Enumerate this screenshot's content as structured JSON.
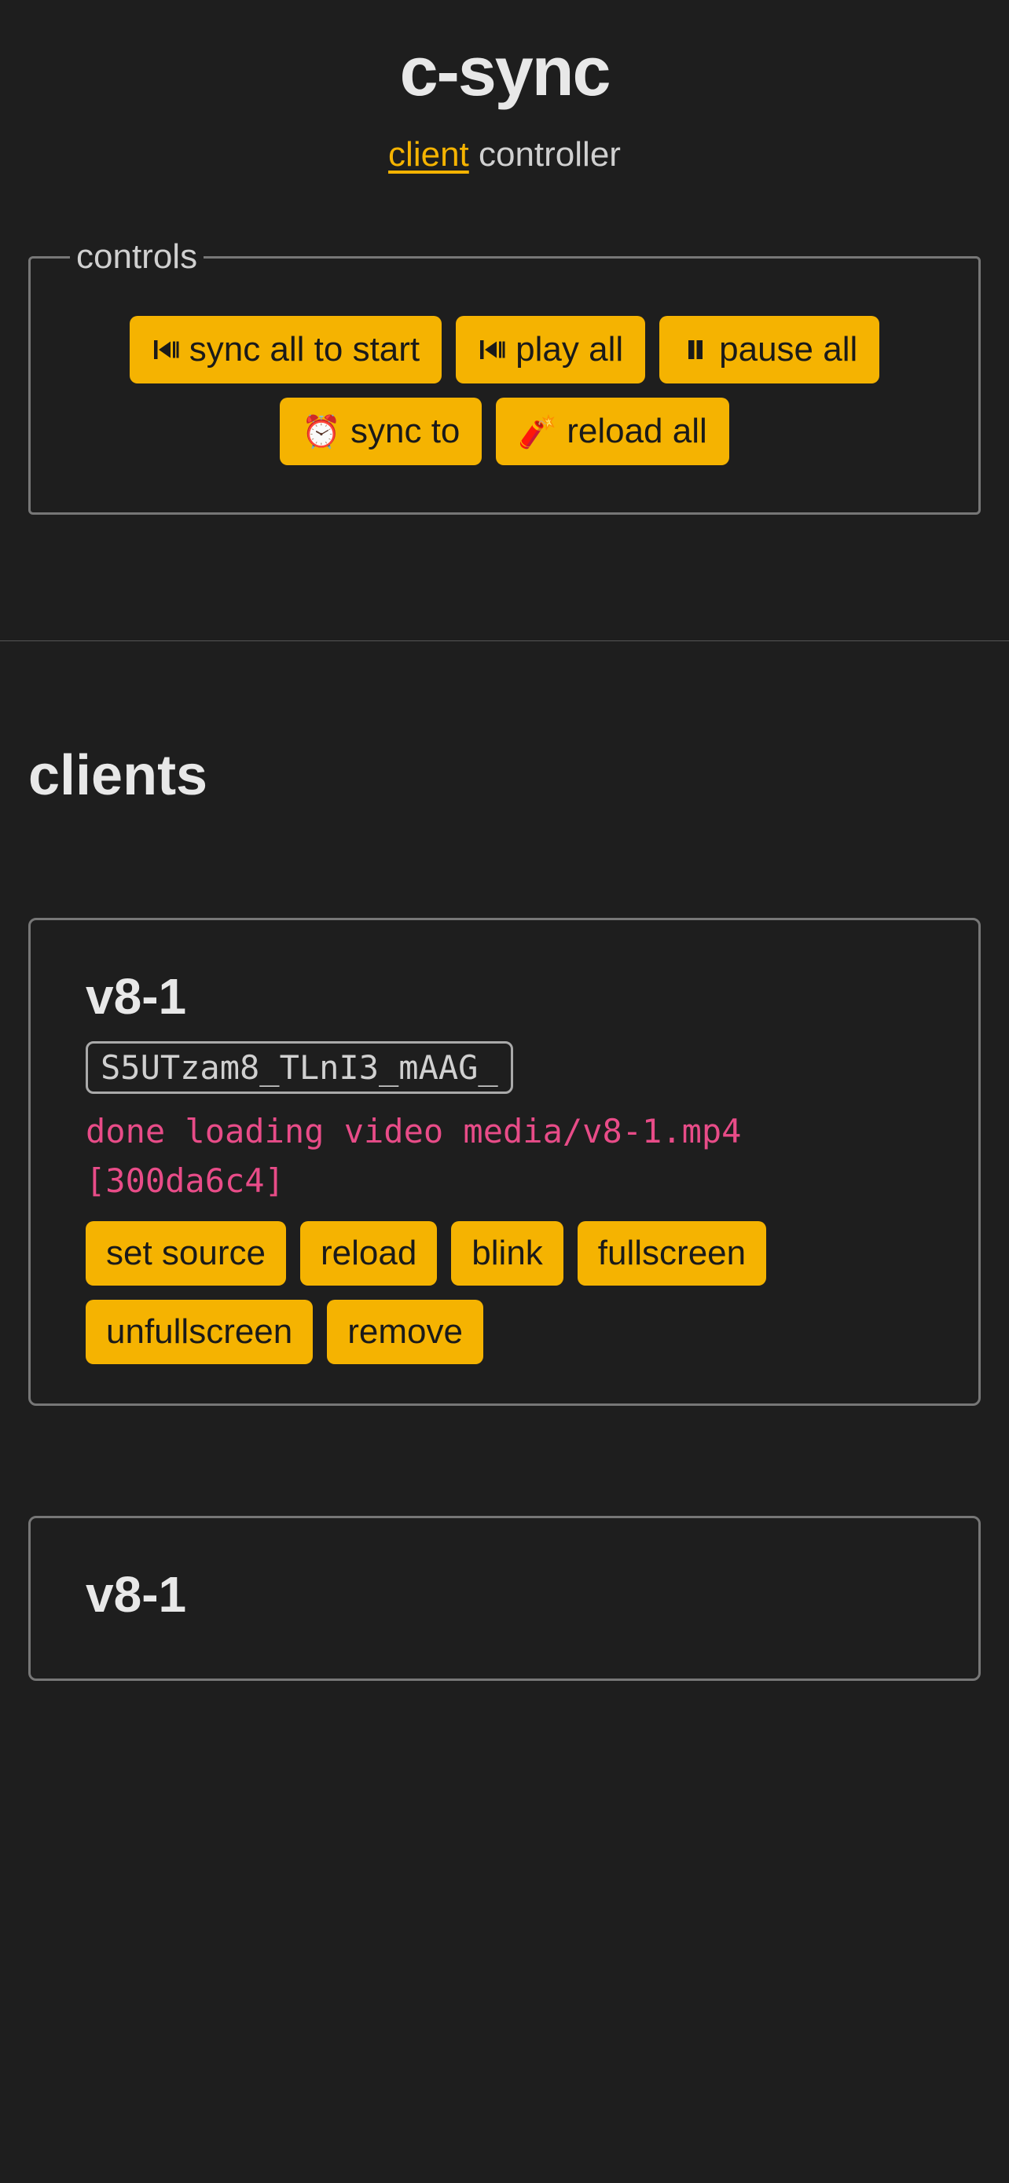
{
  "header": {
    "title": "c-sync",
    "subtitle_link": "client",
    "subtitle_rest": " controller"
  },
  "controls": {
    "legend": "controls",
    "buttons": {
      "sync_all": "sync all to start",
      "play_all": "play all",
      "pause_all": "pause all",
      "sync_to": "sync to",
      "reload_all": "reload all"
    },
    "icons": {
      "sync_all": "skip-play-pause",
      "play_all": "skip-play-pause",
      "pause_all": "pause",
      "sync_to_emoji": "⏰",
      "reload_all_emoji": "🧨"
    }
  },
  "clients": {
    "heading": "clients",
    "items": [
      {
        "name": "v8-1",
        "id": "S5UTzam8_TLnI3_mAAG_",
        "status": "done loading video media/v8-1.mp4 [300da6c4]",
        "buttons": {
          "set_source": "set source",
          "reload": "reload",
          "blink": "blink",
          "fullscreen": "fullscreen",
          "unfullscreen": "unfullscreen",
          "remove": "remove"
        }
      },
      {
        "name": "v8-1"
      }
    ]
  }
}
